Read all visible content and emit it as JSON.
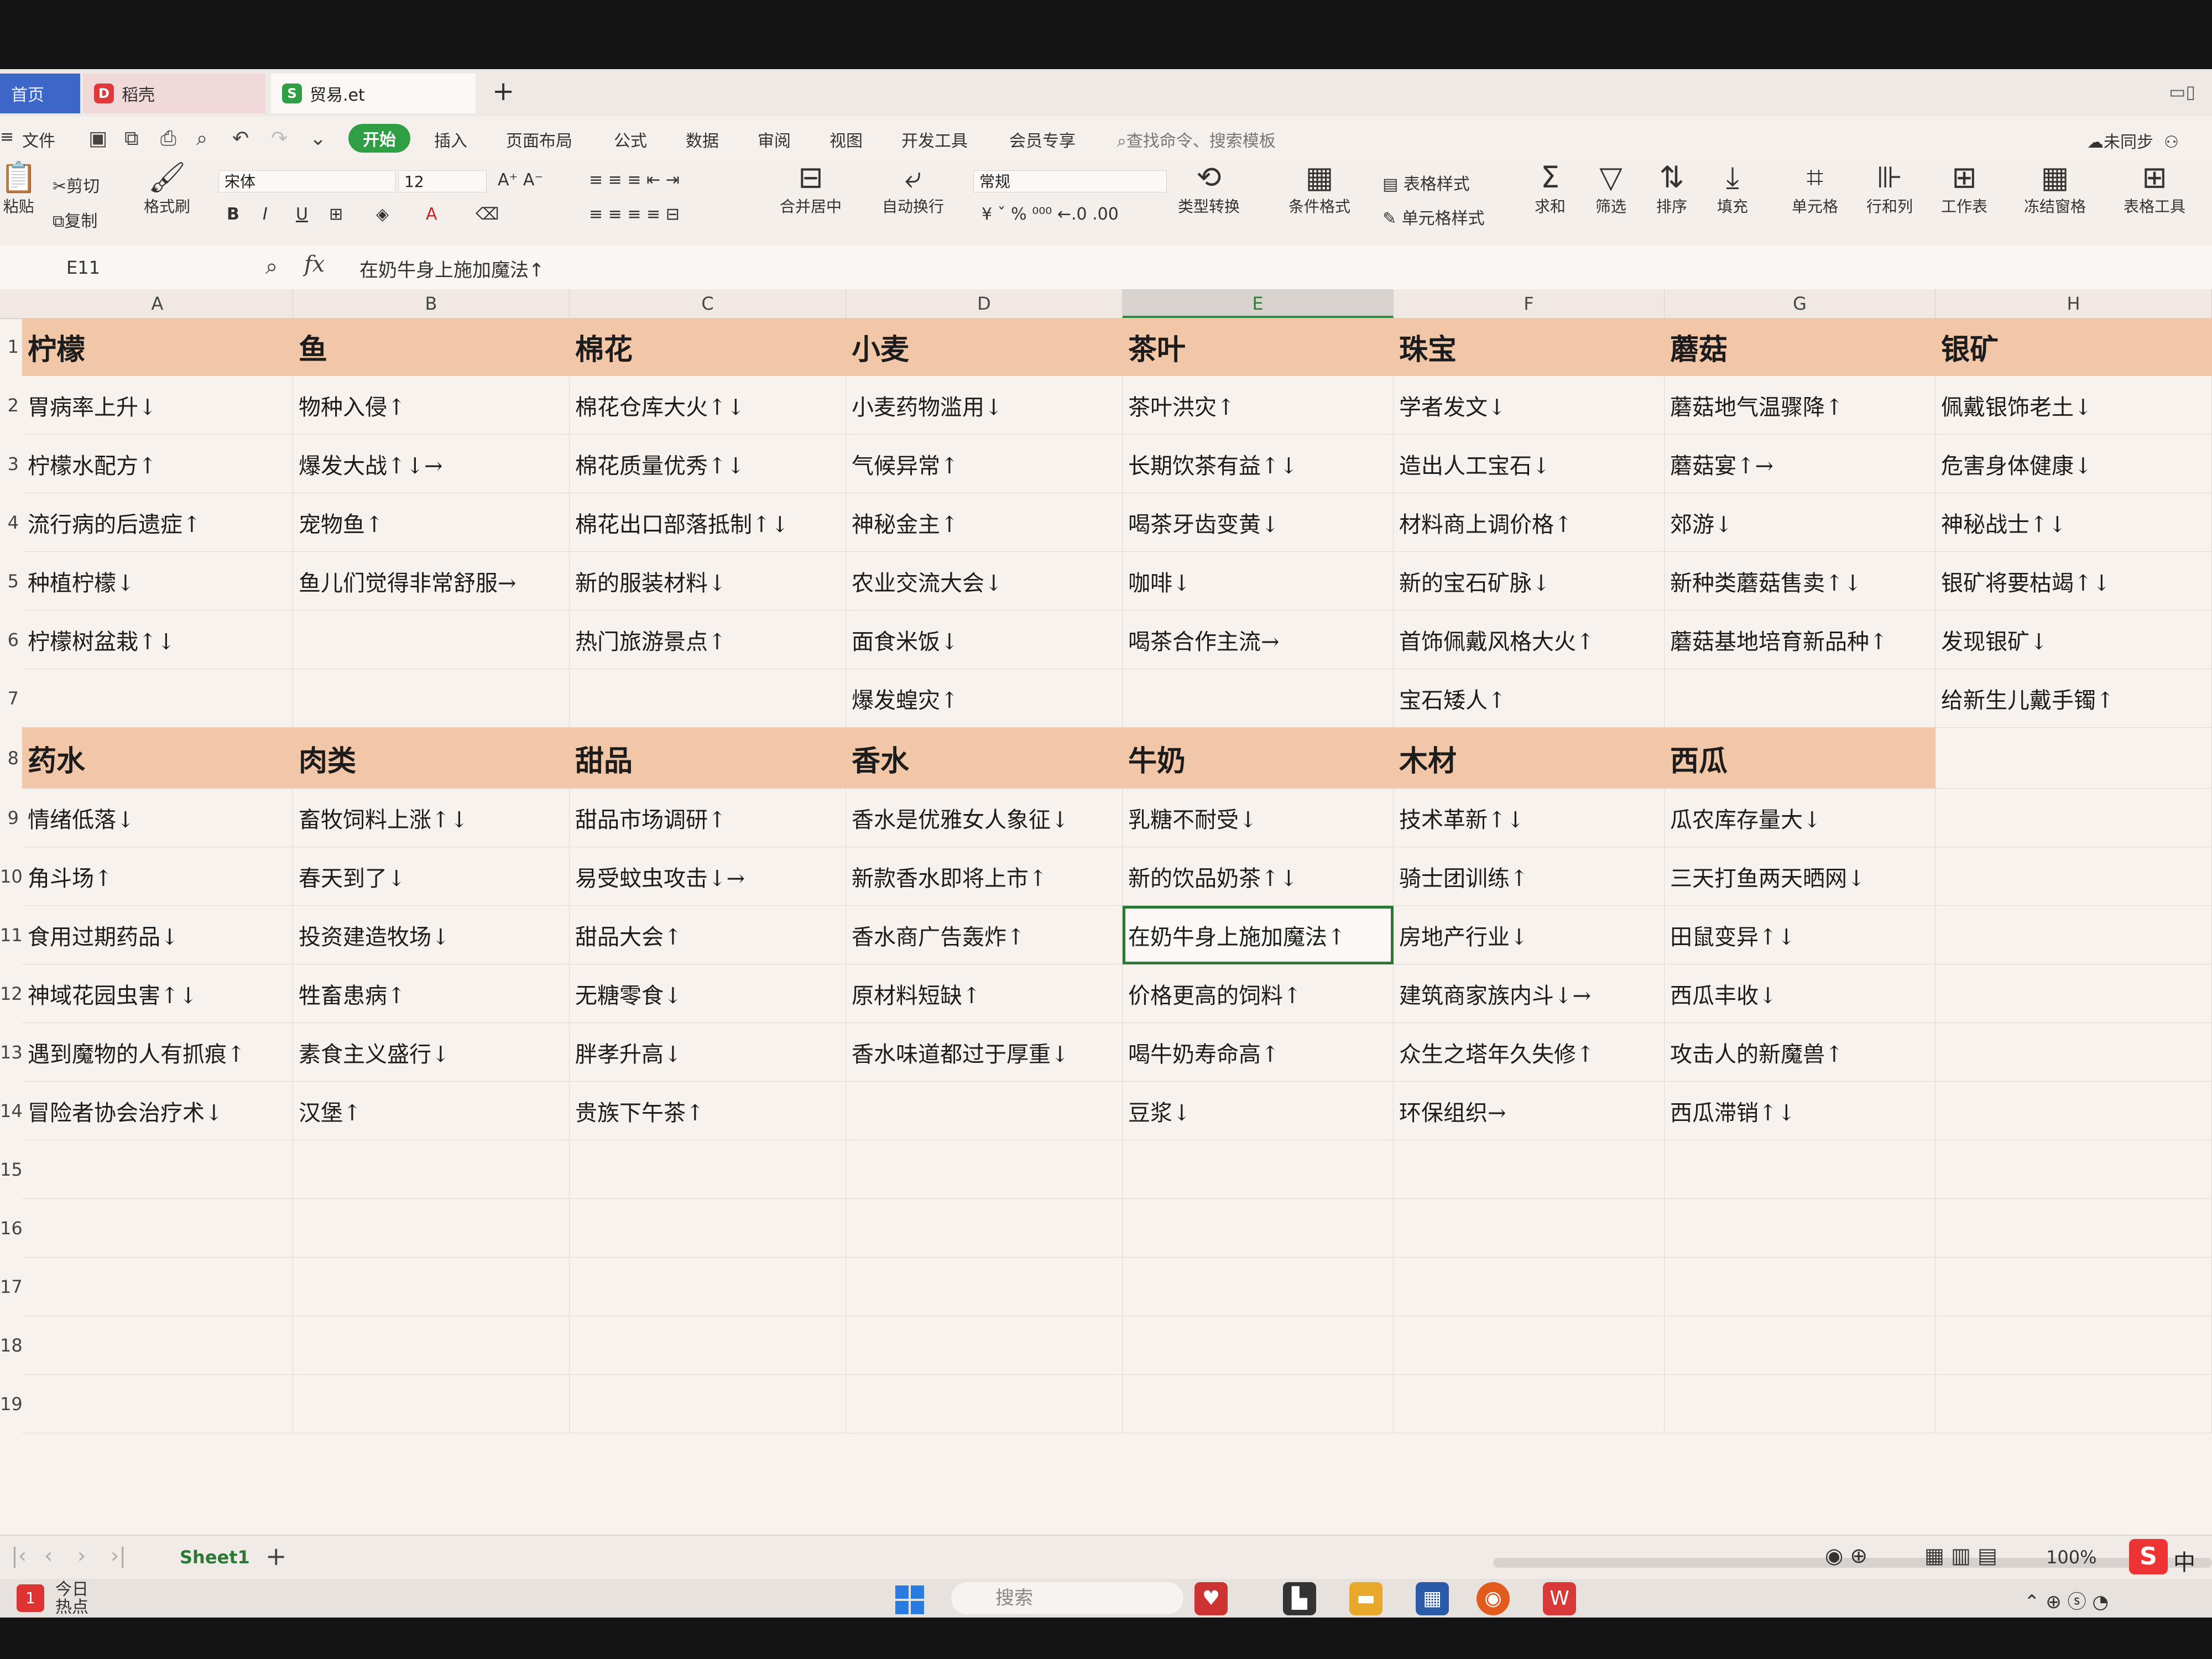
{
  "tabs": {
    "home": "首页",
    "daoke": "稻壳",
    "file": "贸易.et"
  },
  "menu": [
    "文件",
    "开始",
    "插入",
    "页面布局",
    "公式",
    "数据",
    "审阅",
    "视图",
    "开发工具",
    "会员专享"
  ],
  "search_placeholder": "查找命令、搜索模板",
  "sync_label": "未同步",
  "ribbon": {
    "cut": "剪切",
    "paste": "粘贴",
    "copy": "复制",
    "format_painter": "格式刷",
    "font_name": "宋体",
    "font_size": "12",
    "number_format": "常规",
    "merge_center": "合并居中",
    "wrap": "自动换行",
    "type_convert": "类型转换",
    "cond_format": "条件格式",
    "table_style": "表格样式",
    "cell_style": "单元格样式",
    "sum": "求和",
    "filter": "筛选",
    "sort": "排序",
    "fill": "填充",
    "cell": "单元格",
    "row_col": "行和列",
    "worksheet": "工作表",
    "freeze": "冻结窗格",
    "table_tools": "表格工具"
  },
  "formula_bar": {
    "name_box": "E11",
    "fx": "fx",
    "content": "在奶牛身上施加魔法↑"
  },
  "columns": [
    "A",
    "B",
    "C",
    "D",
    "E",
    "F",
    "G",
    "H"
  ],
  "row_numbers": [
    "1",
    "2",
    "3",
    "4",
    "5",
    "6",
    "7",
    "8",
    "9",
    "10",
    "11",
    "12",
    "13",
    "14",
    "15",
    "16",
    "17",
    "18",
    "19"
  ],
  "headers_top": [
    "柠檬",
    "鱼",
    "棉花",
    "小麦",
    "茶叶",
    "珠宝",
    "蘑菇",
    "银矿"
  ],
  "rows_top": [
    [
      "胃病率上升↓",
      "物种入侵↑",
      "棉花仓库大火↑↓",
      "小麦药物滥用↓",
      "茶叶洪灾↑",
      "学者发文↓",
      "蘑菇地气温骤降↑",
      "佩戴银饰老土↓"
    ],
    [
      "柠檬水配方↑",
      "爆发大战↑↓→",
      "棉花质量优秀↑↓",
      "气候异常↑",
      "长期饮茶有益↑↓",
      "造出人工宝石↓",
      "蘑菇宴↑→",
      "危害身体健康↓"
    ],
    [
      "流行病的后遗症↑",
      "宠物鱼↑",
      "棉花出口部落抵制↑↓",
      "神秘金主↑",
      "喝茶牙齿变黄↓",
      "材料商上调价格↑",
      "郊游↓",
      "神秘战士↑↓"
    ],
    [
      "种植柠檬↓",
      "鱼儿们觉得非常舒服→",
      "新的服装材料↓",
      "农业交流大会↓",
      "咖啡↓",
      "新的宝石矿脉↓",
      "新种类蘑菇售卖↑↓",
      "银矿将要枯竭↑↓"
    ],
    [
      "柠檬树盆栽↑↓",
      "",
      "热门旅游景点↑",
      "面食米饭↓",
      "喝茶合作主流→",
      "首饰佩戴风格大火↑",
      "蘑菇基地培育新品种↑",
      "发现银矿↓"
    ],
    [
      "",
      "",
      "",
      "爆发蝗灾↑",
      "",
      "宝石矮人↑",
      "",
      "给新生儿戴手镯↑"
    ]
  ],
  "headers_bottom": [
    "药水",
    "肉类",
    "甜品",
    "香水",
    "牛奶",
    "木材",
    "西瓜",
    ""
  ],
  "rows_bottom": [
    [
      "情绪低落↓",
      "畜牧饲料上涨↑↓",
      "甜品市场调研↑",
      "香水是优雅女人象征↓",
      "乳糖不耐受↓",
      "技术革新↑↓",
      "瓜农库存量大↓",
      ""
    ],
    [
      "角斗场↑",
      "春天到了↓",
      "易受蚊虫攻击↓→",
      "新款香水即将上市↑",
      "新的饮品奶茶↑↓",
      "骑士团训练↑",
      "三天打鱼两天晒网↓",
      ""
    ],
    [
      "食用过期药品↓",
      "投资建造牧场↓",
      "甜品大会↑",
      "香水商广告轰炸↑",
      "在奶牛身上施加魔法↑",
      "房地产行业↓",
      "田鼠变异↑↓",
      ""
    ],
    [
      "神域花园虫害↑↓",
      "牲畜患病↑",
      "无糖零食↓",
      "原材料短缺↑",
      "价格更高的饲料↑",
      "建筑商家族内斗↓→",
      "西瓜丰收↓",
      ""
    ],
    [
      "遇到魔物的人有抓痕↑",
      "素食主义盛行↓",
      "胖孝升高↓",
      "香水味道都过于厚重↓",
      "喝牛奶寿命高↑",
      "众生之塔年久失修↑",
      "攻击人的新魔兽↑",
      ""
    ],
    [
      "冒险者协会治疗术↓",
      "汉堡↑",
      "贵族下午茶↑",
      "",
      "豆浆↓",
      "环保组织→",
      "西瓜滞销↑↓",
      ""
    ]
  ],
  "sheet_tab": "Sheet1",
  "zoom": "100%",
  "ime_label": "中",
  "taskbar": {
    "today": "今日",
    "hot": "热点",
    "badge": "1",
    "search": "搜索"
  },
  "colors": {
    "header_fill": "#f2c7a7",
    "accent_green": "#2f9e44",
    "selection": "#2a7a34"
  }
}
